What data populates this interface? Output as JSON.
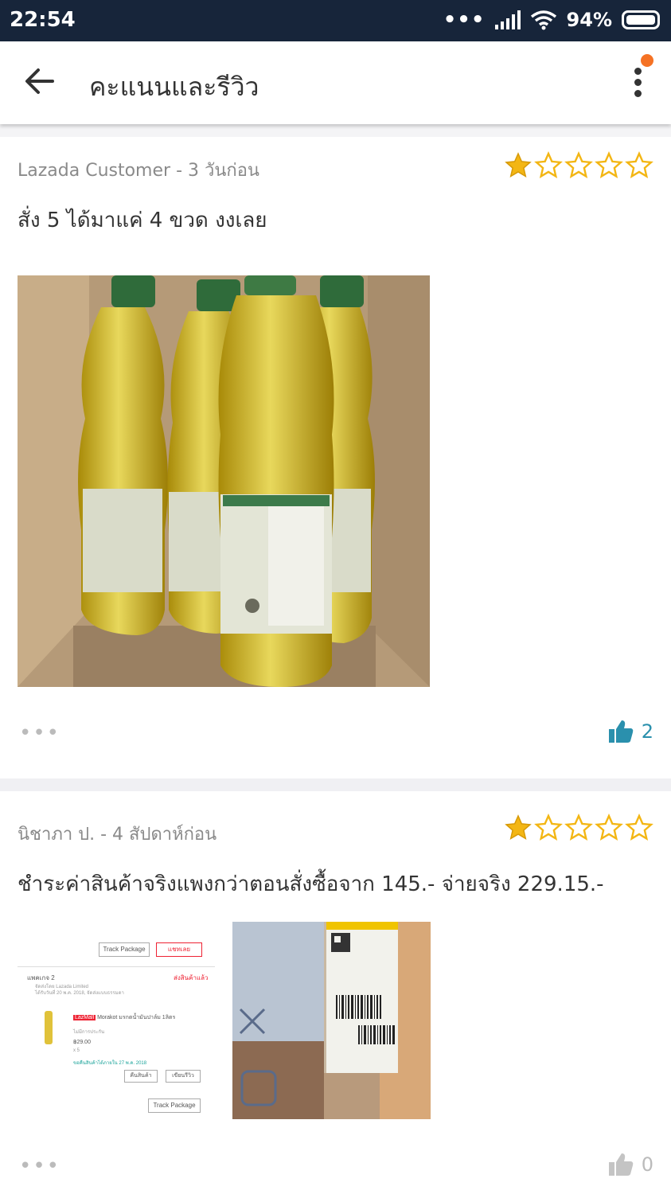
{
  "status_bar": {
    "time": "22:54",
    "battery": "94%",
    "dots": "•••"
  },
  "header": {
    "title": "คะแนนและรีวิว"
  },
  "colors": {
    "accent": "#2a90ad",
    "star": "#f3b614",
    "notification": "#f57224"
  },
  "reviews": [
    {
      "author_time": "Lazada Customer - 3 วันก่อน",
      "rating": 1,
      "max_rating": 5,
      "text": "สั่ง 5 ได้มาแค่ 4 ขวด งงเลย",
      "likes": "2",
      "liked": true,
      "photos": [
        "photo-oil-bottles-box"
      ]
    },
    {
      "author_time": "นิชาภา ป. - 4 สัปดาห์ก่อน",
      "rating": 1,
      "max_rating": 5,
      "text": "ชำระค่าสินค้าจริงแพงกว่าตอนสั่งซื้อจาก 145.- จ่ายจริง 229.15.-",
      "likes": "0",
      "liked": false,
      "photos": [
        "photo-order-screenshot",
        "photo-shipping-box"
      ],
      "order_screenshot": {
        "track_package": "Track Package",
        "contact_seller": "แชทเลย",
        "package": "แพคเกจ 2",
        "delivered": "ส่งสินค้าแล้ว",
        "shipper": "จัดส่งโดย Lazada Limited",
        "received": "ได้รับวันที่ 20 พ.ค. 2018, จัดส่งแบบธรรมดา",
        "store_tag": "LazMall",
        "product": "Morakot มรกตน้ำมันปาล์ม 1ลิตร",
        "warranty": "ไม่มีการประกัน",
        "price": "฿29.00",
        "qty": "x 5",
        "return_note": "ขอคืนสินค้าได้ภายใน 27 พ.ค. 2018",
        "return_button": "คืนสินค้า",
        "review_button": "เขียนรีวิว"
      }
    }
  ]
}
